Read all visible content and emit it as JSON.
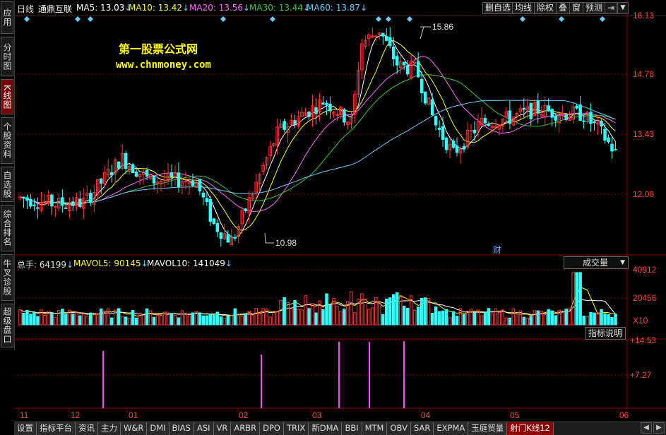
{
  "left_tabs": [
    {
      "label": "应用",
      "active": false
    },
    {
      "label": "分时图",
      "active": false
    },
    {
      "label": "K线图",
      "active": true
    },
    {
      "label": "个股资料",
      "active": false
    },
    {
      "label": "自选股",
      "active": false
    },
    {
      "label": "综合排名",
      "active": false
    },
    {
      "label": "牛叉诊股",
      "active": false
    },
    {
      "label": "超级盘口",
      "active": false
    }
  ],
  "header": {
    "period": "日线",
    "stock_name": "通鼎互联",
    "ma": [
      {
        "label": "MA5: 13.03",
        "color": "#ffffff"
      },
      {
        "label": "MA10: 13.42",
        "color": "#ffff00"
      },
      {
        "label": "MA20: 13.56",
        "color": "#ff66ff"
      },
      {
        "label": "MA30: 13.44",
        "color": "#33cc33"
      },
      {
        "label": "MA60: 13.87",
        "color": "#66ccff"
      }
    ],
    "toolbar": [
      "删自选",
      "均线",
      "除权",
      "叠",
      "窗",
      "预测"
    ],
    "down_arrow": "↓"
  },
  "watermark": {
    "title": "第一股票公式网",
    "url": "www.chnmoney.com"
  },
  "price_axis": [
    "16.13",
    "14.78",
    "13.43",
    "12.08"
  ],
  "annotations": {
    "high": "15.86",
    "low": "10.98",
    "finance_marker": "财"
  },
  "volume": {
    "total": "总手: 64199",
    "mavol5": "MAVOL5: 90145",
    "mavol10": "MAVOL10: 141049",
    "selector": "成交量",
    "axis": [
      "40912",
      "20456",
      "X10"
    ],
    "indicator_button": "指标说明"
  },
  "signal": {
    "axis": [
      "+14.53",
      "+7.27"
    ]
  },
  "date_axis": [
    "11",
    "12",
    "01",
    "02",
    "03",
    "04",
    "05",
    "06"
  ],
  "bottom_tabs": [
    {
      "label": "设置",
      "active": false
    },
    {
      "label": "指标平台",
      "active": false
    },
    {
      "label": "资讯",
      "active": false
    },
    {
      "label": "主力",
      "active": false
    },
    {
      "label": "W&R",
      "active": false
    },
    {
      "label": "DMI",
      "active": false
    },
    {
      "label": "BIAS",
      "active": false
    },
    {
      "label": "ASI",
      "active": false
    },
    {
      "label": "VR",
      "active": false
    },
    {
      "label": "ARBR",
      "active": false
    },
    {
      "label": "DPO",
      "active": false
    },
    {
      "label": "TRIX",
      "active": false
    },
    {
      "label": "新DMA",
      "active": false
    },
    {
      "label": "BBI",
      "active": false
    },
    {
      "label": "MTM",
      "active": false
    },
    {
      "label": "OBV",
      "active": false
    },
    {
      "label": "SAR",
      "active": false
    },
    {
      "label": "EXPMA",
      "active": false
    },
    {
      "label": "玉庭贸量",
      "active": false
    },
    {
      "label": "射门K线12",
      "active": true
    }
  ],
  "colors": {
    "up": "#ff3333",
    "down": "#33ffff",
    "grid": "#8a0000",
    "signal": "#ff44ff"
  }
}
